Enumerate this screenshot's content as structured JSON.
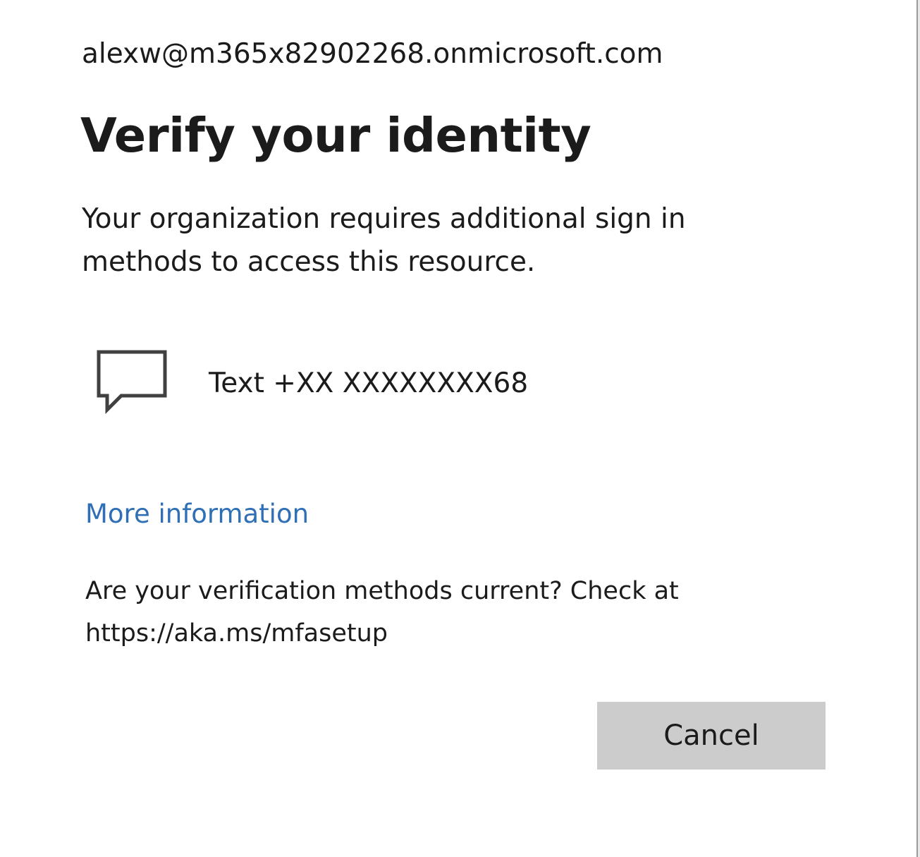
{
  "account": {
    "email": "alexw@m365x82902268.onmicrosoft.com"
  },
  "header": {
    "title": "Verify your identity"
  },
  "description": "Your organization requires additional sign in methods to access this resource.",
  "methods": [
    {
      "icon": "chat-bubble-icon",
      "label": "Text +XX XXXXXXXX68"
    }
  ],
  "links": {
    "more_info": "More information"
  },
  "setup_note": "Are your verification methods current? Check at https://aka.ms/mfasetup",
  "buttons": {
    "cancel": "Cancel"
  },
  "colors": {
    "link": "#2f6fb5",
    "button_bg": "#cccccc",
    "text": "#1b1b1b"
  }
}
